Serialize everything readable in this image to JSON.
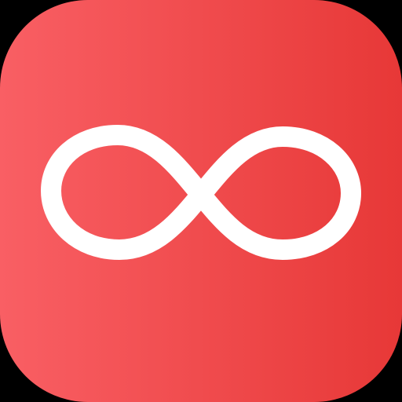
{
  "icon": {
    "name": "infinity-app-icon",
    "symbol": "infinity",
    "colors": {
      "background": "#000000",
      "gradient_start": "#F95F64",
      "gradient_end": "#E73837",
      "glyph": "#FFFFFF"
    }
  }
}
